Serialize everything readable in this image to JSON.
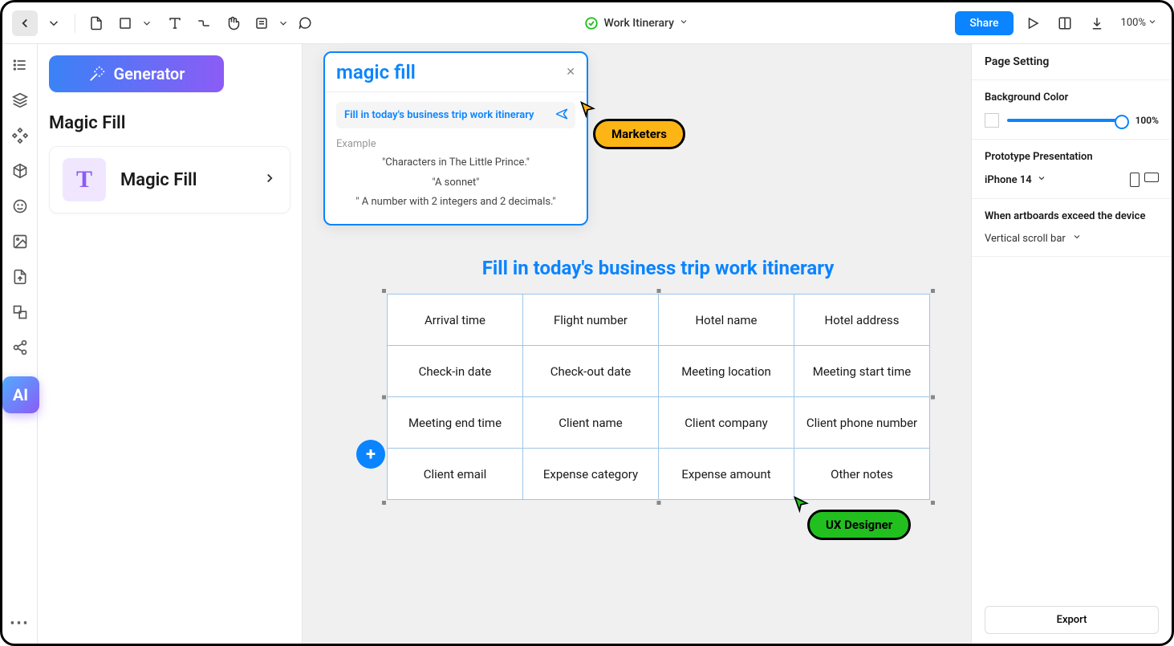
{
  "toolbar": {
    "doc_title": "Work Itinerary",
    "share_label": "Share",
    "zoom": "100%"
  },
  "left_panel": {
    "generator_label": "Generator",
    "section_title": "Magic Fill",
    "card_icon": "T",
    "card_label": "Magic Fill"
  },
  "magic_fill": {
    "title": "magic fill",
    "prompt": "Fill in today's business trip work itinerary",
    "example_label": "Example",
    "examples": [
      "\"Characters in The Little Prince.\"",
      "\"A sonnet\"",
      "\" A number with 2 integers and 2 decimals.\""
    ]
  },
  "cursors": {
    "marketer": "Marketers",
    "designer": "UX Designer"
  },
  "canvas": {
    "title": "Fill in today's business trip work itinerary",
    "cells": [
      [
        "Arrival time",
        "Flight number",
        "Hotel name",
        "Hotel address"
      ],
      [
        "Check-in date",
        "Check-out date",
        "Meeting location",
        "Meeting start time"
      ],
      [
        "Meeting end time",
        "Client name",
        "Client company",
        "Client phone number"
      ],
      [
        "Client email",
        "Expense category",
        "Expense amount",
        "Other notes"
      ]
    ]
  },
  "right_panel": {
    "page_setting": "Page Setting",
    "bg_label": "Background Color",
    "bg_pct": "100%",
    "proto_label": "Prototype Presentation",
    "device": "iPhone 14",
    "exceed_label": "When artboards exceed the device",
    "scroll_mode": "Vertical scroll bar",
    "export": "Export"
  },
  "ai_badge": "AI"
}
